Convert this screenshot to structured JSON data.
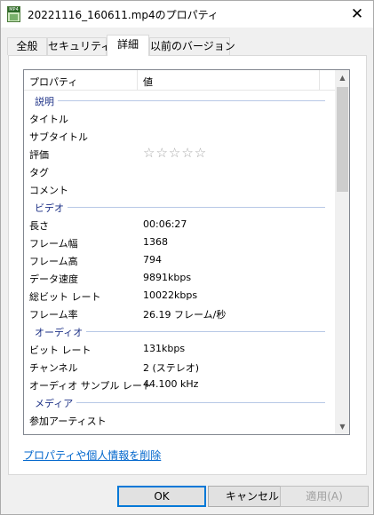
{
  "window": {
    "title": "20221116_160611.mp4のプロパティ",
    "icon": "mp4-file-icon",
    "icon_band": "MP4"
  },
  "tabs": [
    {
      "label": "全般"
    },
    {
      "label": "セキュリティ"
    },
    {
      "label": "詳細",
      "active": true
    },
    {
      "label": "以前のバージョン"
    }
  ],
  "list": {
    "header": {
      "property": "プロパティ",
      "value": "値"
    },
    "groups": {
      "description": "説明",
      "video": "ビデオ",
      "audio": "オーディオ",
      "media": "メディア"
    },
    "description_rows": [
      {
        "label": "タイトル",
        "value": ""
      },
      {
        "label": "サブタイトル",
        "value": ""
      },
      {
        "label": "評価",
        "value": ""
      },
      {
        "label": "タグ",
        "value": ""
      },
      {
        "label": "コメント",
        "value": ""
      }
    ],
    "rating": {
      "stars": "☆☆☆☆☆",
      "value": 0,
      "max": 5
    },
    "video_rows": [
      {
        "label": "長さ",
        "value": "00:06:27"
      },
      {
        "label": "フレーム幅",
        "value": "1368"
      },
      {
        "label": "フレーム高",
        "value": "794"
      },
      {
        "label": "データ速度",
        "value": "9891kbps"
      },
      {
        "label": "総ビット レート",
        "value": "10022kbps"
      },
      {
        "label": "フレーム率",
        "value": "26.19 フレーム/秒"
      }
    ],
    "audio_rows": [
      {
        "label": "ビット レート",
        "value": "131kbps"
      },
      {
        "label": "チャンネル",
        "value": "2 (ステレオ)"
      },
      {
        "label": "オーディオ サンプル レート",
        "value": "44.100 kHz"
      }
    ],
    "media_rows": [
      {
        "label": "参加アーティスト",
        "value": ""
      }
    ]
  },
  "remove_link": "プロパティや個人情報を削除",
  "buttons": {
    "ok": "OK",
    "cancel": "キャンセル",
    "apply": "適用(A)"
  },
  "colors": {
    "group_text": "#1e3287",
    "link": "#0066cc",
    "ok_border": "#0078d7"
  }
}
